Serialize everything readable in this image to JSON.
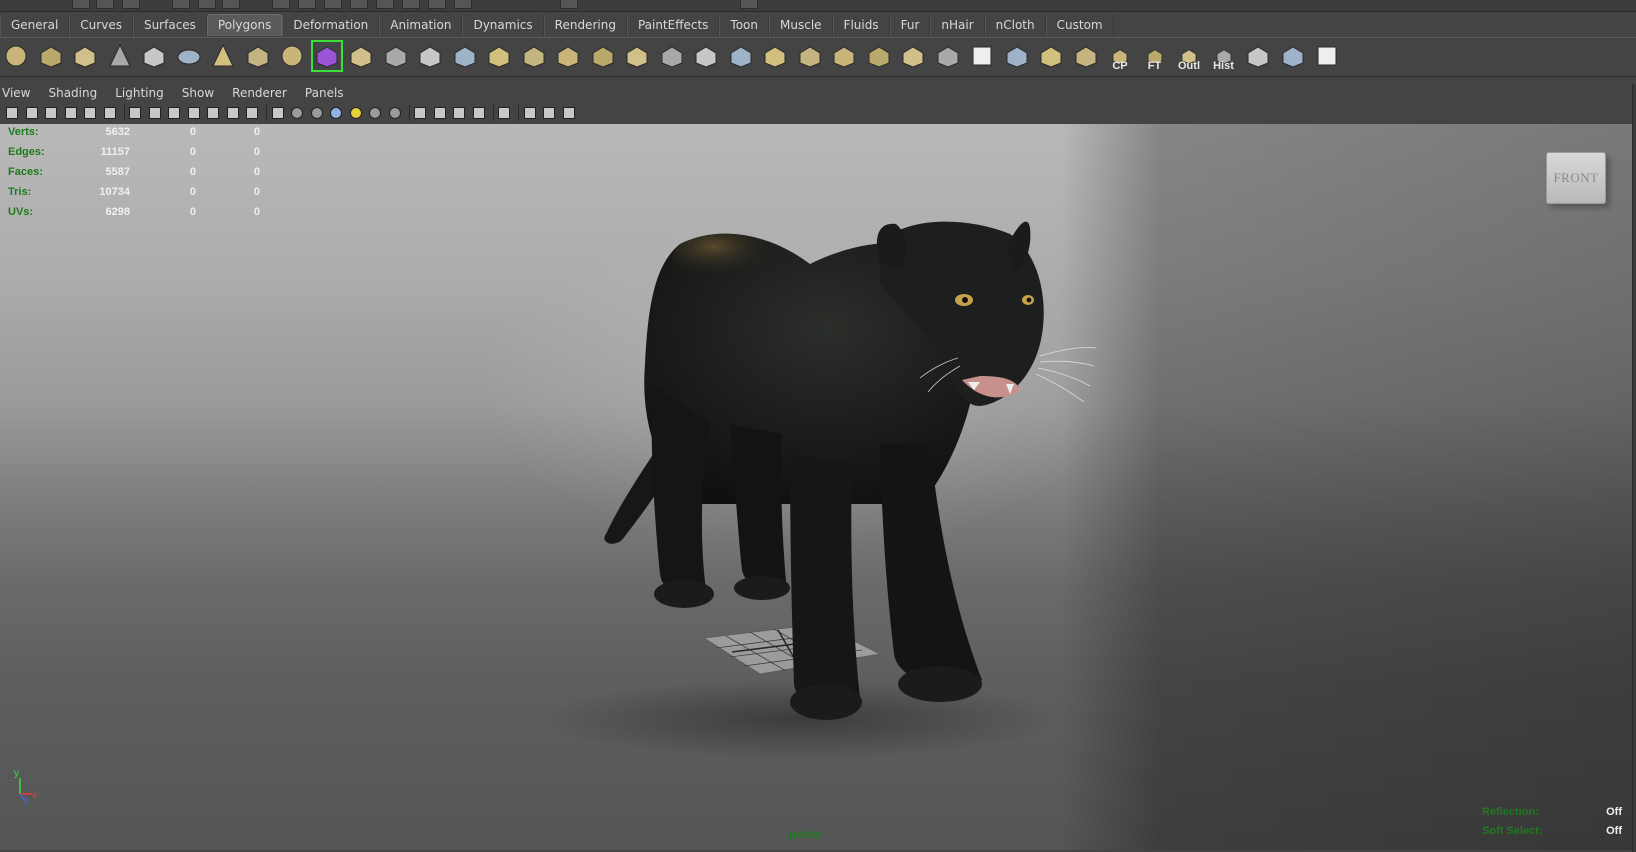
{
  "shelf": {
    "tabs": [
      "General",
      "Curves",
      "Surfaces",
      "Polygons",
      "Deformation",
      "Animation",
      "Dynamics",
      "Rendering",
      "PaintEffects",
      "Toon",
      "Muscle",
      "Fluids",
      "Fur",
      "nHair",
      "nCloth",
      "Custom"
    ],
    "active_tab": "Polygons",
    "icons": [
      {
        "name": "poly-sphere-icon"
      },
      {
        "name": "poly-cube-icon"
      },
      {
        "name": "poly-cylinder-icon"
      },
      {
        "name": "poly-cone-icon"
      },
      {
        "name": "poly-plane-icon"
      },
      {
        "name": "poly-torus-icon"
      },
      {
        "name": "poly-pyramid-icon"
      },
      {
        "name": "poly-pipe-icon"
      },
      {
        "name": "poly-soccer-ball-icon"
      },
      {
        "name": "create-polygon-tool-icon"
      },
      {
        "name": "combine-icon"
      },
      {
        "name": "separate-icon"
      },
      {
        "name": "smooth-proxy-icon"
      },
      {
        "name": "extrude-icon"
      },
      {
        "name": "bridge-icon"
      },
      {
        "name": "append-polygon-icon"
      },
      {
        "name": "split-polygon-icon"
      },
      {
        "name": "insert-edge-loop-icon"
      },
      {
        "name": "offset-edge-loop-icon"
      },
      {
        "name": "bevel-icon"
      },
      {
        "name": "merge-vertices-icon"
      },
      {
        "name": "collapse-icon"
      },
      {
        "name": "wedge-icon"
      },
      {
        "name": "poke-icon"
      },
      {
        "name": "smooth-icon"
      },
      {
        "name": "sculpt-icon"
      },
      {
        "name": "planar-mapping-icon"
      },
      {
        "name": "cylindrical-mapping-icon"
      },
      {
        "name": "uv-checker-icon"
      },
      {
        "name": "uv-texture-editor-icon"
      },
      {
        "name": "uv-snapshot-icon"
      },
      {
        "name": "uv-layout-icon"
      },
      {
        "name": "center-pivot-icon",
        "label": "CP"
      },
      {
        "name": "freeze-transforms-icon",
        "label": "FT"
      },
      {
        "name": "outliner-icon",
        "label": "Outl"
      },
      {
        "name": "history-icon",
        "label": "Hist"
      },
      {
        "name": "transfer-attributes-icon"
      },
      {
        "name": "soften-edge-icon"
      },
      {
        "name": "uv-grid-icon"
      }
    ]
  },
  "panel": {
    "menu": [
      "View",
      "Shading",
      "Lighting",
      "Show",
      "Renderer",
      "Panels"
    ]
  },
  "hud": {
    "rows": [
      {
        "label": "Verts:",
        "v1": "5632",
        "v2": "0",
        "v3": "0"
      },
      {
        "label": "Edges:",
        "v1": "11157",
        "v2": "0",
        "v3": "0"
      },
      {
        "label": "Faces:",
        "v1": "5587",
        "v2": "0",
        "v3": "0"
      },
      {
        "label": "Tris:",
        "v1": "10734",
        "v2": "0",
        "v3": "0"
      },
      {
        "label": "UVs:",
        "v1": "6298",
        "v2": "0",
        "v3": "0"
      }
    ],
    "camera": "persp",
    "reflection_label": "Reflection:",
    "reflection_value": "Off",
    "soft_select_label": "Soft Select:",
    "soft_select_value": "Off"
  },
  "viewcube": {
    "face": "FRONT"
  },
  "axis": {
    "y": "y",
    "z": "z",
    "x": "x"
  },
  "colors": {
    "hud_label": "#1e7a1e",
    "selected_outline": "#3adf3a",
    "ui_bg": "#444444"
  }
}
